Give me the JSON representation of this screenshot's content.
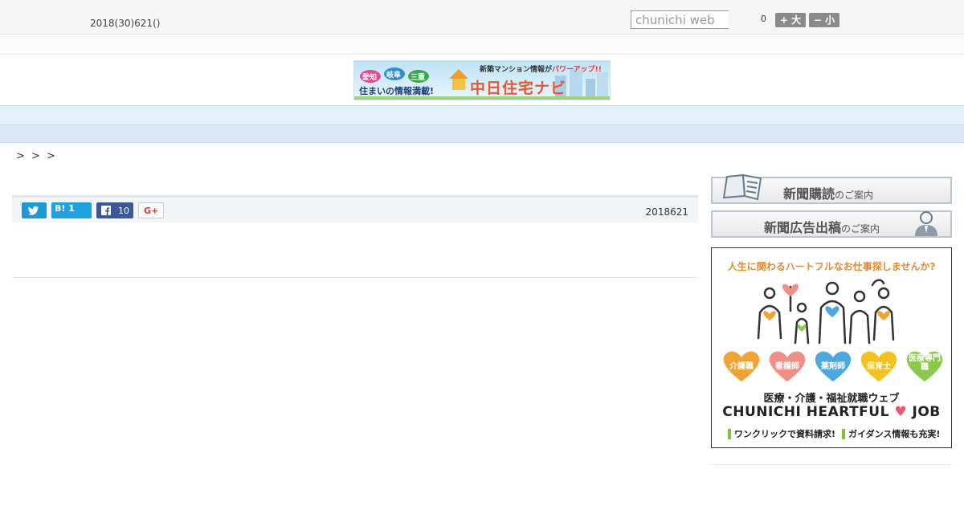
{
  "header": {
    "date": "2018(30)621()",
    "search_placeholder": "chunichi web",
    "counter": "0",
    "font_large": "+ 大",
    "font_small": "− 小"
  },
  "banner": {
    "pref_1": "愛知",
    "pref_2": "岐阜",
    "pref_3": "三重",
    "tagline": "住まいの情報満載!",
    "headline_prefix": "新築マンション情報が",
    "headline_emphasis": "パワーアップ!!",
    "brand": "中日住宅ナビ"
  },
  "nav": {
    "items": [
      "",
      "",
      "",
      "",
      "",
      "",
      "",
      "",
      ""
    ]
  },
  "breadcrumb": ">  > >",
  "share": {
    "hatena_label": "B! 1",
    "facebook_count": "10",
    "gplus_label": "G+"
  },
  "article": {
    "date": "2018621"
  },
  "sidebar": {
    "subscribe_main": "新聞購読",
    "subscribe_sub": "のご案内",
    "ad_main": "新聞広告出稿",
    "ad_sub": "のご案内"
  },
  "heartful": {
    "headline": "人生に関わるハートフルなお仕事探しませんか?",
    "jobs": [
      "介護職",
      "看護師",
      "薬剤師",
      "保育士",
      "医療専門職"
    ],
    "subtitle": "医療・介護・福祉就職ウェブ",
    "brand_1": "CHUNICHI HEARTFUL",
    "brand_2": "JOB",
    "foot_1": "ワンクリックで資料請求!",
    "foot_2": "ガイダンス情報も充実!"
  },
  "colors": {
    "nav_bg": "#e4f0fb",
    "twitter": "#1d9ad6",
    "hatena": "#1ea1e0",
    "facebook": "#3b5998",
    "heart_orange": "#f0a335",
    "heart_pink": "#ef8f86",
    "heart_blue": "#4ea8e0",
    "heart_yellow": "#f3c120",
    "heart_green": "#8cc84b"
  }
}
